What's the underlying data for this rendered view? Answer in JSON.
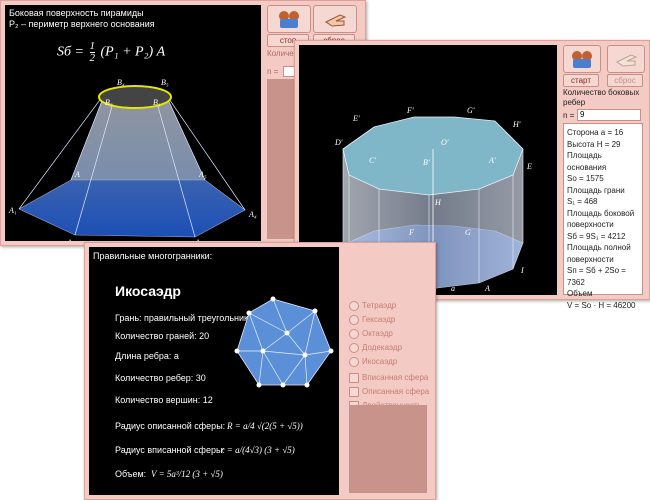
{
  "win1": {
    "title": "Боковая поверхность пирамиды",
    "subtitle": "P₂ – периметр верхнего основания",
    "formula": {
      "lhs": "Sб =",
      "half_num": "1",
      "half_den": "2",
      "rest": "(P₁ + P₂) A"
    },
    "vertices": [
      "B₄",
      "B₅",
      "B₃",
      "B₁",
      "A",
      "A₁",
      "A₂",
      "A₃",
      "A₄",
      "A₅"
    ],
    "buttons": {
      "stop": "стоп",
      "reset": "сброс"
    },
    "side_text": "Количество боковых",
    "n_label": "n ="
  },
  "win2": {
    "buttons": {
      "start": "старт",
      "reset": "сброс"
    },
    "count_label": "Количество боковых ребер",
    "n_label": "n =",
    "n_value": "9",
    "vertices": [
      "E'",
      "F'",
      "G'",
      "H'",
      "D'",
      "C'",
      "B'",
      "A'",
      "O'",
      "H",
      "E",
      "F",
      "G",
      "D",
      "C",
      "B",
      "a",
      "A",
      "I"
    ],
    "info": [
      "Сторона a = 16",
      "Высота H = 29",
      "Площадь основания",
      "Sо = 1575",
      "Площадь грани",
      "S₁ = 468",
      "Площадь боковой",
      "поверхности",
      "Sб = 9S₁ = 4212",
      "Площадь полной",
      "поверхности",
      "Sп = Sб + 2Sо = 7362",
      "Объем",
      "V = Sо · H = 46200"
    ]
  },
  "win3": {
    "header": "Правильные многогранники:",
    "name": "Икосаэдр",
    "face": "Грань:  правильный треугольник",
    "faces": "Количество граней:  20",
    "edge_len": "Длина ребра:  a",
    "edges": "Количество ребер:  30",
    "verts": "Количество вершин:  12",
    "r_out_label": "Радиус описанной сферы:",
    "r_out_formula": "R = a/4 √(2(5 + √5))",
    "r_in_label": "Радиус вписанной сферы:",
    "r_in_formula": "r = a/(4√3) (3 + √5)",
    "vol_label": "Объем:",
    "vol_formula": "V = 5a³/12 (3 + √5)",
    "options": [
      "Тетраэдр",
      "Гексаэдр",
      "Октаэдр",
      "Додекаэдр",
      "Икосаэдр"
    ],
    "checks": [
      "Вписанная сфера",
      "Описанная сфера",
      "Двойственность"
    ]
  }
}
